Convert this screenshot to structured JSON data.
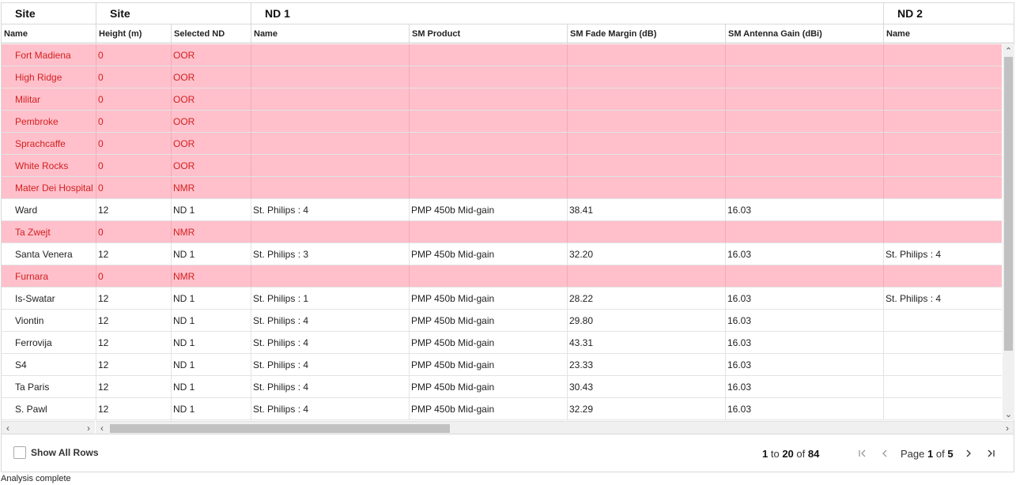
{
  "group_headers": {
    "site_left": "Site",
    "site": "Site",
    "nd1": "ND 1",
    "nd2": "ND 2"
  },
  "columns": {
    "name": "Name",
    "height": "Height (m)",
    "selected_nd": "Selected ND",
    "nd1_name": "Name",
    "sm_product": "SM Product",
    "sm_fade_margin": "SM Fade Margin (dB)",
    "sm_antenna_gain": "SM Antenna Gain (dBi)",
    "nd2_name": "Name"
  },
  "rows": [
    {
      "name": "Fort Madiena",
      "height": "0",
      "selected_nd": "OOR",
      "nd1_name": "",
      "sm_product": "",
      "fade": "",
      "gain": "",
      "nd2_name": "",
      "status": "oor"
    },
    {
      "name": "High Ridge",
      "height": "0",
      "selected_nd": "OOR",
      "nd1_name": "",
      "sm_product": "",
      "fade": "",
      "gain": "",
      "nd2_name": "",
      "status": "oor"
    },
    {
      "name": "Militar",
      "height": "0",
      "selected_nd": "OOR",
      "nd1_name": "",
      "sm_product": "",
      "fade": "",
      "gain": "",
      "nd2_name": "",
      "status": "oor"
    },
    {
      "name": "Pembroke",
      "height": "0",
      "selected_nd": "OOR",
      "nd1_name": "",
      "sm_product": "",
      "fade": "",
      "gain": "",
      "nd2_name": "",
      "status": "oor"
    },
    {
      "name": "Sprachcaffe",
      "height": "0",
      "selected_nd": "OOR",
      "nd1_name": "",
      "sm_product": "",
      "fade": "",
      "gain": "",
      "nd2_name": "",
      "status": "oor"
    },
    {
      "name": "White Rocks",
      "height": "0",
      "selected_nd": "OOR",
      "nd1_name": "",
      "sm_product": "",
      "fade": "",
      "gain": "",
      "nd2_name": "",
      "status": "oor"
    },
    {
      "name": "Mater Dei Hospital",
      "height": "0",
      "selected_nd": "NMR",
      "nd1_name": "",
      "sm_product": "",
      "fade": "",
      "gain": "",
      "nd2_name": "",
      "status": "oor"
    },
    {
      "name": "Ward",
      "height": "12",
      "selected_nd": "ND 1",
      "nd1_name": "St. Philips : 4",
      "sm_product": "PMP 450b Mid-gain",
      "fade": "38.41",
      "gain": "16.03",
      "nd2_name": "",
      "status": "ok"
    },
    {
      "name": "Ta Zwejt",
      "height": "0",
      "selected_nd": "NMR",
      "nd1_name": "",
      "sm_product": "",
      "fade": "",
      "gain": "",
      "nd2_name": "",
      "status": "oor"
    },
    {
      "name": "Santa Venera",
      "height": "12",
      "selected_nd": "ND 1",
      "nd1_name": "St. Philips : 3",
      "sm_product": "PMP 450b Mid-gain",
      "fade": "32.20",
      "gain": "16.03",
      "nd2_name": "St. Philips : 4",
      "status": "ok"
    },
    {
      "name": "Furnara",
      "height": "0",
      "selected_nd": "NMR",
      "nd1_name": "",
      "sm_product": "",
      "fade": "",
      "gain": "",
      "nd2_name": "",
      "status": "oor"
    },
    {
      "name": "Is-Swatar",
      "height": "12",
      "selected_nd": "ND 1",
      "nd1_name": "St. Philips : 1",
      "sm_product": "PMP 450b Mid-gain",
      "fade": "28.22",
      "gain": "16.03",
      "nd2_name": "St. Philips : 4",
      "status": "ok"
    },
    {
      "name": "Viontin",
      "height": "12",
      "selected_nd": "ND 1",
      "nd1_name": "St. Philips : 4",
      "sm_product": "PMP 450b Mid-gain",
      "fade": "29.80",
      "gain": "16.03",
      "nd2_name": "",
      "status": "ok"
    },
    {
      "name": "Ferrovija",
      "height": "12",
      "selected_nd": "ND 1",
      "nd1_name": "St. Philips : 4",
      "sm_product": "PMP 450b Mid-gain",
      "fade": "43.31",
      "gain": "16.03",
      "nd2_name": "",
      "status": "ok"
    },
    {
      "name": "S4",
      "height": "12",
      "selected_nd": "ND 1",
      "nd1_name": "St. Philips : 4",
      "sm_product": "PMP 450b Mid-gain",
      "fade": "23.33",
      "gain": "16.03",
      "nd2_name": "",
      "status": "ok"
    },
    {
      "name": "Ta Paris",
      "height": "12",
      "selected_nd": "ND 1",
      "nd1_name": "St. Philips : 4",
      "sm_product": "PMP 450b Mid-gain",
      "fade": "30.43",
      "gain": "16.03",
      "nd2_name": "",
      "status": "ok"
    },
    {
      "name": "S. Pawl",
      "height": "12",
      "selected_nd": "ND 1",
      "nd1_name": "St. Philips : 4",
      "sm_product": "PMP 450b Mid-gain",
      "fade": "32.29",
      "gain": "16.03",
      "nd2_name": "",
      "status": "ok"
    }
  ],
  "row_status_colors": {
    "oor_background": "#ffc0cb",
    "oor_text": "#d21f1f"
  },
  "footer": {
    "show_all_label": "Show All Rows",
    "range_from": "1",
    "range_to_word": "to",
    "range_to": "20",
    "range_of_word": "of",
    "range_total": "84",
    "page_word": "Page",
    "page_current": "1",
    "page_of_word": "of",
    "page_total": "5"
  },
  "icons": {
    "first_page": "first-page-icon",
    "prev_page": "prev-page-icon",
    "next_page": "next-page-icon",
    "last_page": "last-page-icon"
  },
  "status_bar": "Analysis complete"
}
